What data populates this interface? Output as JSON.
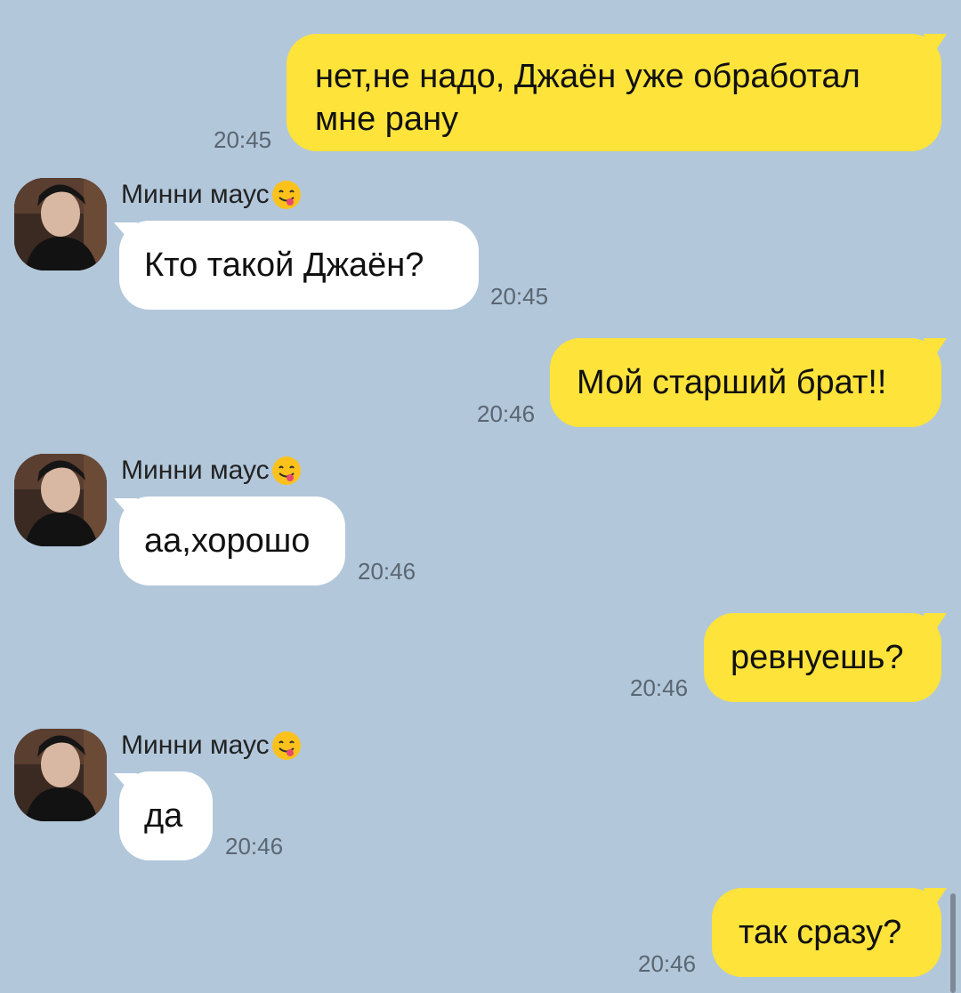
{
  "chat": {
    "messages": [
      {
        "direction": "out",
        "text": "нет,не надо, Джаён уже обработал мне рану",
        "time": "20:45"
      },
      {
        "direction": "in",
        "sender": "Минни маус",
        "sender_emoji": "yum-face-emoji",
        "text": "Кто такой Джаён?",
        "time": "20:45"
      },
      {
        "direction": "out",
        "text": "Мой старший брат!!",
        "time": "20:46"
      },
      {
        "direction": "in",
        "sender": "Минни маус",
        "sender_emoji": "yum-face-emoji",
        "text": "аа,хорошо",
        "time": "20:46"
      },
      {
        "direction": "out",
        "text": "ревнуешь?",
        "time": "20:46"
      },
      {
        "direction": "in",
        "sender": "Минни маус",
        "sender_emoji": "yum-face-emoji",
        "text": "да",
        "time": "20:46"
      },
      {
        "direction": "out",
        "text": "так сразу?",
        "time": "20:46"
      }
    ]
  },
  "colors": {
    "background": "#b2c7da",
    "outgoing_bubble": "#fee33b",
    "incoming_bubble": "#ffffff",
    "timestamp": "#5a6672"
  }
}
